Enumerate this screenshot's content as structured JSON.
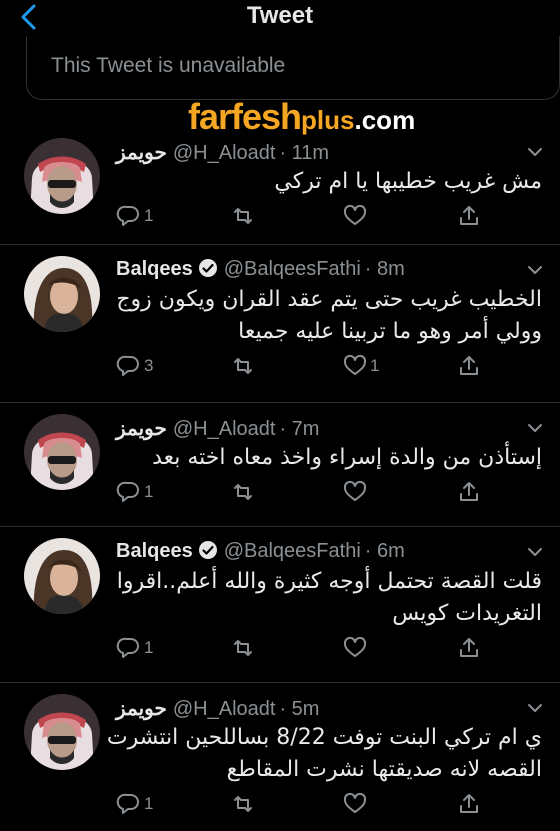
{
  "header": {
    "title": "Tweet"
  },
  "unavailable_notice": "This Tweet is unavailable",
  "watermark": {
    "part1": "farfesh",
    "part2": "plus",
    "part3": ".com"
  },
  "tweets": [
    {
      "name": "حويمز",
      "handle": "@H_Aloadt",
      "time": "· 11m",
      "verified": false,
      "lines": [
        "مش غريب خطيبها يا ام تركي"
      ],
      "counts": {
        "replies": "1",
        "retweets": "",
        "likes": ""
      }
    },
    {
      "name": "Balqees",
      "handle": "@BalqeesFathi",
      "time": "· 8m",
      "verified": true,
      "lines": [
        "الخطيب غريب حتى يتم عقد القران ويكون زوج",
        "وولي أمر وهو ما تربينا عليه جميعا"
      ],
      "counts": {
        "replies": "3",
        "retweets": "",
        "likes": "1"
      }
    },
    {
      "name": "حويمز",
      "handle": "@H_Aloadt",
      "time": "· 7m",
      "verified": false,
      "lines": [
        "إستأذن من والدة إسراء واخذ معاه اخته بعد"
      ],
      "counts": {
        "replies": "1",
        "retweets": "",
        "likes": ""
      }
    },
    {
      "name": "Balqees",
      "handle": "@BalqeesFathi",
      "time": "· 6m",
      "verified": true,
      "lines": [
        "قلت القصة تحتمل أوجه كثيرة والله أعلم..اقروا",
        "التغريدات كويس"
      ],
      "counts": {
        "replies": "1",
        "retweets": "",
        "likes": ""
      }
    },
    {
      "name": "حويمز",
      "handle": "@H_Aloadt",
      "time": "· 5m",
      "verified": false,
      "lines": [
        "ي ام تركي البنت توفت 8/22 بساللحين انتشرت",
        "القصه لانه صديقتها نشرت المقاطع"
      ],
      "counts": {
        "replies": "1",
        "retweets": "",
        "likes": ""
      }
    }
  ]
}
